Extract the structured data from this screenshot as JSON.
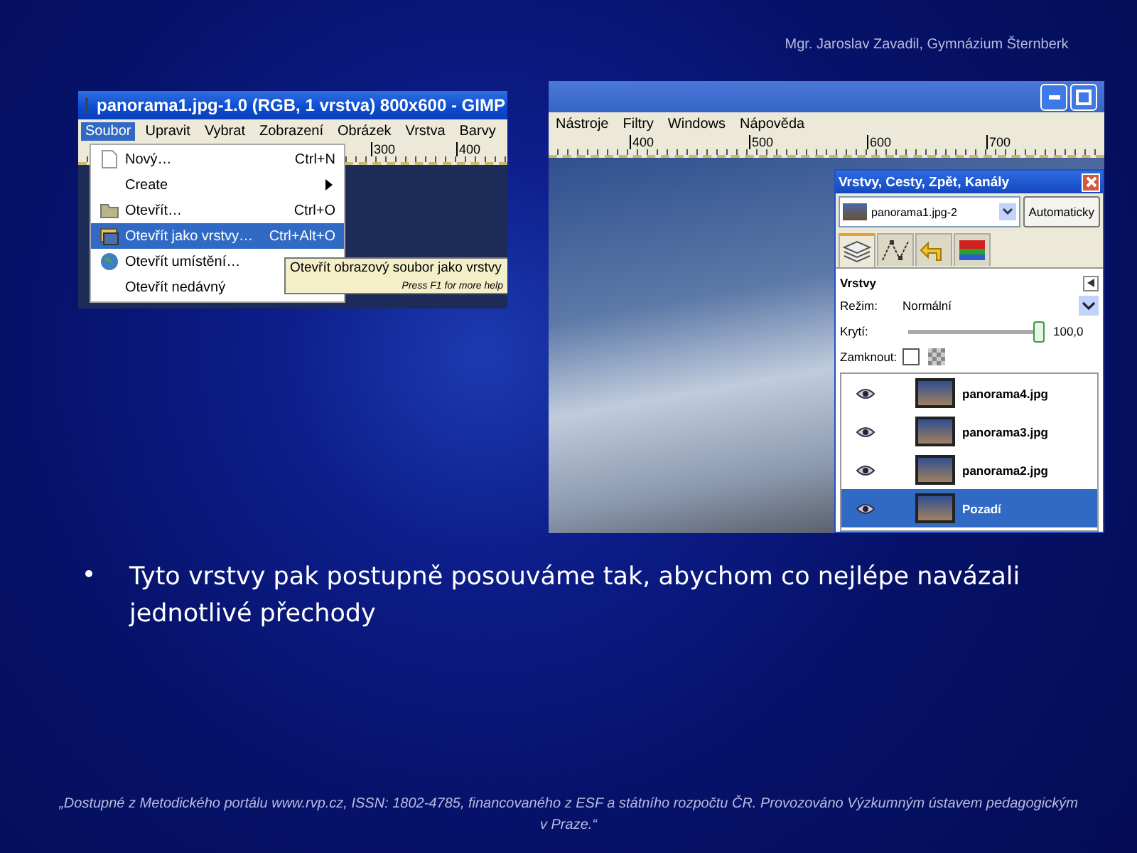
{
  "author": "Mgr. Jaroslav Zavadil, Gymnázium Šternberk",
  "screenshot_left": {
    "title": "panorama1.jpg-1.0 (RGB, 1 vrstva) 800x600 - GIMP",
    "menubar": [
      {
        "label": "Soubor",
        "selected": true
      },
      {
        "label": "Upravit",
        "selected": false
      },
      {
        "label": "Vybrat",
        "selected": false
      },
      {
        "label": "Zobrazení",
        "selected": false
      },
      {
        "label": "Obrázek",
        "selected": false
      },
      {
        "label": "Vrstva",
        "selected": false
      },
      {
        "label": "Barvy",
        "selected": false
      }
    ],
    "ruler": [
      "300",
      "400"
    ],
    "menu": [
      {
        "kind": "document",
        "label": "Nový…",
        "shortcut": "Ctrl+N",
        "selected": false
      },
      {
        "kind": "submenu",
        "label": "Create",
        "selected": false
      },
      {
        "kind": "folder",
        "label": "Otevřít…",
        "shortcut": "Ctrl+O",
        "selected": false
      },
      {
        "kind": "layers",
        "label": "Otevřít jako vrstvy…",
        "shortcut": "Ctrl+Alt+O",
        "selected": true
      },
      {
        "kind": "globe",
        "label": "Otevřít umístění…",
        "selected": false
      },
      {
        "kind": "plain",
        "label": "Otevřít nedávný",
        "selected": false
      }
    ],
    "tooltip": {
      "text": "Otevřít obrazový soubor jako vrstvy",
      "hint": "Press F1 for more help"
    }
  },
  "screenshot_right": {
    "menubar": [
      "Nástroje",
      "Filtry",
      "Windows",
      "Nápověda"
    ],
    "ruler": [
      "400",
      "500",
      "600",
      "700"
    ],
    "dock": {
      "title": "Vrstvy, Cesty, Zpět, Kanály",
      "image": "panorama1.jpg-2",
      "auto_button": "Automaticky",
      "tabs": [
        {
          "kind": "layers",
          "selected": true
        },
        {
          "kind": "paths",
          "selected": false
        },
        {
          "kind": "undo",
          "selected": false
        },
        {
          "kind": "channels",
          "selected": false
        }
      ],
      "section": "Vrstvy",
      "mode_label": "Režim:",
      "mode": "Normální",
      "opacity": {
        "label": "Krytí:",
        "level": 1,
        "reading": "100,0"
      },
      "lock": {
        "label": "Zamknout:",
        "checked": false
      },
      "layers": [
        {
          "name": "panorama4.jpg",
          "visible": true,
          "selected": false
        },
        {
          "name": "panorama3.jpg",
          "visible": true,
          "selected": false
        },
        {
          "name": "panorama2.jpg",
          "visible": true,
          "selected": false
        },
        {
          "name": "Pozadí",
          "visible": true,
          "selected": true
        }
      ]
    }
  },
  "bullet": "Tyto vrstvy pak postupně posouváme tak, abychom co nejlépe navázali jednotlivé přechody",
  "footer": "„Dostupné z Metodického portálu www.rvp.cz, ISSN: 1802-4785, financovaného z ESF a státního rozpočtu ČR. Provozováno Výzkumným ústavem pedagogickým v Praze.“"
}
